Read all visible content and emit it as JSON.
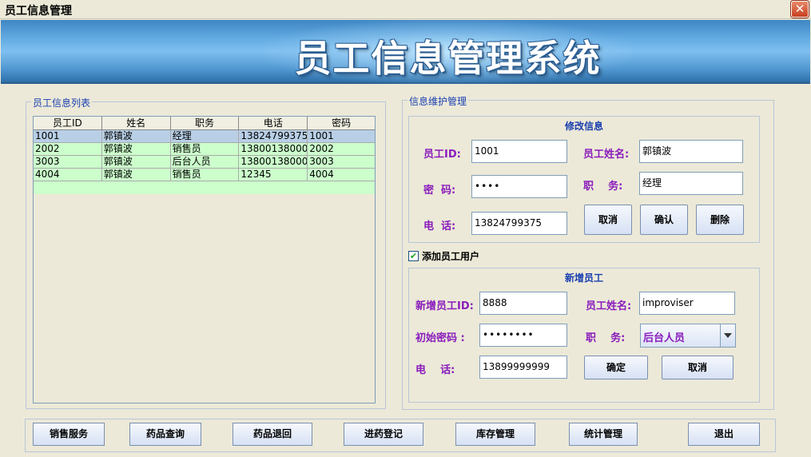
{
  "window": {
    "title": "员工信息管理",
    "close_icon": "close-icon"
  },
  "banner": {
    "heading": "员工信息管理系统"
  },
  "list_group": {
    "legend": "员工信息列表",
    "columns": [
      "员工ID",
      "姓名",
      "职务",
      "电话",
      "密码"
    ],
    "rows": [
      [
        "1001",
        "郭镇波",
        "经理",
        "13824799375",
        "1001"
      ],
      [
        "2002",
        "郭镇波",
        "销售员",
        "13800138000",
        "2002"
      ],
      [
        "3003",
        "郭镇波",
        "后台人员",
        "13800138000",
        "3003"
      ],
      [
        "4004",
        "郭镇波",
        "销售员",
        "12345",
        "4004"
      ]
    ]
  },
  "maint_group": {
    "legend": "信息维护管理",
    "edit": {
      "title": "修改信息",
      "id_label": "员工ID:",
      "id_value": "1001",
      "name_label": "员工姓名:",
      "name_value": "郭镇波",
      "password_label": "密  码:",
      "password_value": "••••",
      "role_label": "职    务:",
      "role_value": "经理",
      "phone_label": "电  话:",
      "phone_value": "13824799375",
      "cancel_label": "取消",
      "confirm_label": "确认",
      "delete_label": "删除"
    },
    "add_checkbox": {
      "label": "添加员工用户",
      "checked": true,
      "mark": "✔"
    },
    "add": {
      "title": "新增员工",
      "id_label": "新增员工ID:",
      "id_value": "8888",
      "name_label": "员工姓名:",
      "name_value": "improviser",
      "password_label": "初始密码 :",
      "password_value": "••••••••",
      "role_label": "职    务:",
      "role_value": "后台人员",
      "phone_label": "电    话:",
      "phone_value": "13899999999",
      "ok_label": "确定",
      "cancel_label": "取消"
    }
  },
  "nav": {
    "sales": "销售服务",
    "drug_query": "药品查询",
    "drug_return": "药品退回",
    "purchase": "进药登记",
    "inventory": "库存管理",
    "stats": "统计管理",
    "exit": "退出"
  },
  "colors": {
    "label": "#8a1cbc",
    "legend": "#1a3eb0",
    "row": "#ccffcc",
    "selected_row": "#b8cfe6",
    "banner": "#4e95cf"
  }
}
